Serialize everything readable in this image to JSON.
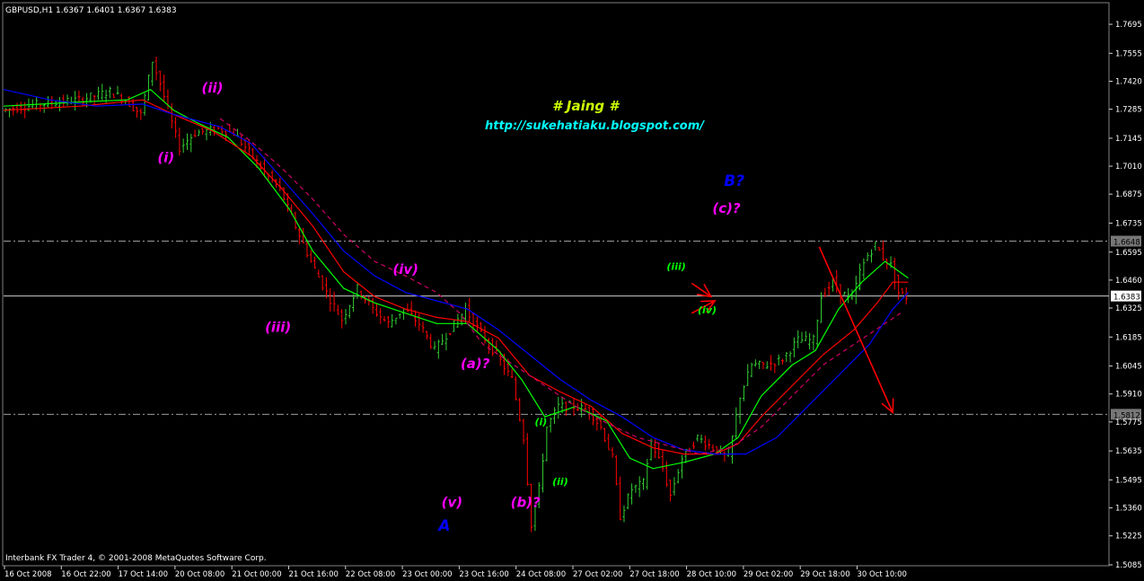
{
  "header": "GBPUSD,H1  1.6367 1.6401 1.6367 1.6383",
  "footer": "Interbank FX Trader 4, © 2001-2008 MetaQuotes Software Corp.",
  "watermark": {
    "title": "# Jaing #",
    "url": "http://sukehatiaku.blogspot.com/"
  },
  "colors": {
    "background": "#000000",
    "grid": "#808080",
    "bull": "#32CD32",
    "bear": "#FF0000",
    "ma_fast": "#00FF00",
    "ma_mid": "#FF0000",
    "ma_slow": "#0000FF",
    "ma_dashed": "#CC0066",
    "label_magenta": "#FF00FF",
    "label_blue": "#0000FF",
    "label_green": "#00FF00",
    "watermark_title": "#CCFF00",
    "watermark_url": "#00FFFF",
    "arrow": "#FF0000"
  },
  "chart_data": {
    "type": "candlestick",
    "symbol": "GBPUSD",
    "timeframe": "H1",
    "ylim": [
      1.5085,
      1.7795
    ],
    "x_ticks": [
      "16 Oct 2008",
      "16 Oct 22:00",
      "17 Oct 14:00",
      "20 Oct 08:00",
      "21 Oct 00:00",
      "21 Oct 16:00",
      "22 Oct 08:00",
      "23 Oct 00:00",
      "23 Oct 16:00",
      "24 Oct 08:00",
      "27 Oct 02:00",
      "27 Oct 18:00",
      "28 Oct 10:00",
      "29 Oct 02:00",
      "29 Oct 18:00",
      "30 Oct 10:00"
    ],
    "y_ticks": [
      "1.7695",
      "1.7555",
      "1.7420",
      "1.7285",
      "1.7145",
      "1.7010",
      "1.6875",
      "1.6735",
      "1.6595",
      "1.6460",
      "1.6325",
      "1.6185",
      "1.6045",
      "1.5910",
      "1.5775",
      "1.5635",
      "1.5495",
      "1.5360",
      "1.5225",
      "1.5085"
    ],
    "horizontal_lines": [
      {
        "value": 1.6648,
        "label": "1.6648",
        "style": "dashdot"
      },
      {
        "value": 1.5812,
        "label": "1.5812",
        "style": "dashdot"
      },
      {
        "value": 1.6383,
        "label": "1.6383",
        "style": "solid"
      }
    ],
    "price_path": [
      [
        0,
        1.728
      ],
      [
        10,
        1.731
      ],
      [
        20,
        1.733
      ],
      [
        28,
        1.737
      ],
      [
        32,
        1.733
      ],
      [
        36,
        1.726
      ],
      [
        39,
        1.752
      ],
      [
        41,
        1.741
      ],
      [
        44,
        1.722
      ],
      [
        46,
        1.71
      ],
      [
        50,
        1.717
      ],
      [
        56,
        1.719
      ],
      [
        60,
        1.717
      ],
      [
        64,
        1.708
      ],
      [
        68,
        1.698
      ],
      [
        72,
        1.69
      ],
      [
        76,
        1.672
      ],
      [
        80,
        1.655
      ],
      [
        84,
        1.64
      ],
      [
        88,
        1.627
      ],
      [
        92,
        1.642
      ],
      [
        96,
        1.632
      ],
      [
        100,
        1.625
      ],
      [
        104,
        1.632
      ],
      [
        108,
        1.625
      ],
      [
        112,
        1.612
      ],
      [
        116,
        1.622
      ],
      [
        120,
        1.632
      ],
      [
        124,
        1.62
      ],
      [
        128,
        1.61
      ],
      [
        132,
        1.598
      ],
      [
        135,
        1.57
      ],
      [
        137,
        1.528
      ],
      [
        139,
        1.545
      ],
      [
        141,
        1.575
      ],
      [
        144,
        1.585
      ],
      [
        148,
        1.585
      ],
      [
        152,
        1.583
      ],
      [
        155,
        1.575
      ],
      [
        158,
        1.56
      ],
      [
        160,
        1.532
      ],
      [
        163,
        1.545
      ],
      [
        166,
        1.548
      ],
      [
        168,
        1.568
      ],
      [
        171,
        1.555
      ],
      [
        173,
        1.542
      ],
      [
        176,
        1.56
      ],
      [
        180,
        1.57
      ],
      [
        184,
        1.565
      ],
      [
        188,
        1.56
      ],
      [
        191,
        1.59
      ],
      [
        194,
        1.605
      ],
      [
        198,
        1.605
      ],
      [
        202,
        1.608
      ],
      [
        206,
        1.617
      ],
      [
        210,
        1.617
      ],
      [
        212,
        1.638
      ],
      [
        215,
        1.645
      ],
      [
        217,
        1.64
      ],
      [
        220,
        1.637
      ],
      [
        222,
        1.65
      ],
      [
        224,
        1.658
      ],
      [
        226,
        1.663
      ],
      [
        228,
        1.657
      ],
      [
        230,
        1.653
      ],
      [
        232,
        1.64
      ],
      [
        234,
        1.638
      ]
    ],
    "moving_averages": [
      {
        "color_key": "ma_fast",
        "style": "solid",
        "points": [
          [
            0,
            1.73
          ],
          [
            20,
            1.732
          ],
          [
            32,
            1.733
          ],
          [
            38,
            1.738
          ],
          [
            44,
            1.728
          ],
          [
            50,
            1.722
          ],
          [
            58,
            1.715
          ],
          [
            66,
            1.7
          ],
          [
            74,
            1.68
          ],
          [
            80,
            1.66
          ],
          [
            88,
            1.642
          ],
          [
            96,
            1.635
          ],
          [
            104,
            1.63
          ],
          [
            112,
            1.625
          ],
          [
            120,
            1.625
          ],
          [
            128,
            1.612
          ],
          [
            134,
            1.598
          ],
          [
            140,
            1.58
          ],
          [
            148,
            1.585
          ],
          [
            156,
            1.578
          ],
          [
            162,
            1.56
          ],
          [
            168,
            1.555
          ],
          [
            176,
            1.558
          ],
          [
            184,
            1.562
          ],
          [
            190,
            1.57
          ],
          [
            196,
            1.59
          ],
          [
            204,
            1.605
          ],
          [
            210,
            1.612
          ],
          [
            216,
            1.632
          ],
          [
            222,
            1.645
          ],
          [
            228,
            1.655
          ],
          [
            234,
            1.647
          ]
        ]
      },
      {
        "color_key": "ma_mid",
        "style": "solid",
        "points": [
          [
            0,
            1.728
          ],
          [
            20,
            1.73
          ],
          [
            36,
            1.733
          ],
          [
            44,
            1.726
          ],
          [
            54,
            1.718
          ],
          [
            64,
            1.706
          ],
          [
            72,
            1.69
          ],
          [
            80,
            1.672
          ],
          [
            88,
            1.65
          ],
          [
            96,
            1.638
          ],
          [
            104,
            1.632
          ],
          [
            112,
            1.628
          ],
          [
            120,
            1.626
          ],
          [
            128,
            1.618
          ],
          [
            136,
            1.6
          ],
          [
            144,
            1.592
          ],
          [
            152,
            1.585
          ],
          [
            160,
            1.572
          ],
          [
            168,
            1.565
          ],
          [
            176,
            1.562
          ],
          [
            184,
            1.562
          ],
          [
            190,
            1.567
          ],
          [
            196,
            1.58
          ],
          [
            204,
            1.595
          ],
          [
            212,
            1.61
          ],
          [
            220,
            1.622
          ],
          [
            226,
            1.635
          ],
          [
            230,
            1.645
          ],
          [
            234,
            1.645
          ]
        ]
      },
      {
        "color_key": "ma_slow",
        "style": "solid",
        "points": [
          [
            0,
            1.738
          ],
          [
            12,
            1.733
          ],
          [
            24,
            1.73
          ],
          [
            36,
            1.731
          ],
          [
            44,
            1.726
          ],
          [
            56,
            1.72
          ],
          [
            64,
            1.712
          ],
          [
            72,
            1.695
          ],
          [
            80,
            1.678
          ],
          [
            88,
            1.66
          ],
          [
            96,
            1.648
          ],
          [
            104,
            1.64
          ],
          [
            112,
            1.636
          ],
          [
            120,
            1.632
          ],
          [
            128,
            1.622
          ],
          [
            136,
            1.61
          ],
          [
            144,
            1.598
          ],
          [
            152,
            1.588
          ],
          [
            160,
            1.58
          ],
          [
            168,
            1.57
          ],
          [
            176,
            1.564
          ],
          [
            184,
            1.562
          ],
          [
            192,
            1.562
          ],
          [
            200,
            1.57
          ],
          [
            208,
            1.585
          ],
          [
            216,
            1.6
          ],
          [
            224,
            1.615
          ],
          [
            230,
            1.632
          ],
          [
            234,
            1.64
          ]
        ]
      },
      {
        "color_key": "ma_dashed",
        "style": "dashed",
        "points": [
          [
            56,
            1.724
          ],
          [
            64,
            1.713
          ],
          [
            72,
            1.7
          ],
          [
            80,
            1.685
          ],
          [
            88,
            1.668
          ],
          [
            96,
            1.655
          ],
          [
            104,
            1.648
          ],
          [
            112,
            1.64
          ],
          [
            118,
            1.63
          ],
          [
            124,
            1.615
          ],
          [
            132,
            1.605
          ],
          [
            140,
            1.595
          ],
          [
            148,
            1.585
          ],
          [
            156,
            1.577
          ],
          [
            164,
            1.57
          ],
          [
            172,
            1.566
          ],
          [
            180,
            1.562
          ],
          [
            188,
            1.565
          ],
          [
            196,
            1.575
          ],
          [
            204,
            1.59
          ],
          [
            212,
            1.605
          ],
          [
            220,
            1.615
          ],
          [
            228,
            1.625
          ],
          [
            232,
            1.63
          ]
        ]
      }
    ]
  },
  "annotations": [
    {
      "text": "(ii)",
      "color_key": "label_magenta",
      "x": 54,
      "y": 1.7365
    },
    {
      "text": "(i)",
      "color_key": "label_magenta",
      "x": 42,
      "y": 1.703
    },
    {
      "text": "(iii)",
      "color_key": "label_magenta",
      "x": 71,
      "y": 1.621
    },
    {
      "text": "(iv)",
      "color_key": "label_magenta",
      "x": 104,
      "y": 1.649
    },
    {
      "text": "(a)?",
      "color_key": "label_magenta",
      "x": 122,
      "y": 1.6035
    },
    {
      "text": "(v)",
      "color_key": "label_magenta",
      "x": 116,
      "y": 1.5365
    },
    {
      "text": "A",
      "color_key": "label_blue",
      "x": 114,
      "y": 1.525
    },
    {
      "text": "(b)?",
      "color_key": "label_magenta",
      "x": 135,
      "y": 1.5365
    },
    {
      "text": "(i)",
      "color_key": "label_green",
      "x": 139,
      "y": 1.576
    },
    {
      "text": "(ii)",
      "color_key": "label_green",
      "x": 144,
      "y": 1.547
    },
    {
      "text": "(iii)",
      "color_key": "label_green",
      "x": 174,
      "y": 1.651
    },
    {
      "text": "(iv)",
      "color_key": "label_green",
      "x": 182,
      "y": 1.63
    },
    {
      "text": "(c)?",
      "color_key": "label_magenta",
      "x": 187,
      "y": 1.6785
    },
    {
      "text": "B?",
      "color_key": "label_blue",
      "x": 189,
      "y": 1.6915
    }
  ],
  "arrows": [
    {
      "from": [
        211,
        1.662
      ],
      "to": [
        230,
        1.582
      ],
      "color_key": "arrow"
    },
    {
      "from": [
        178,
        1.6445
      ],
      "to": [
        183,
        1.638
      ],
      "color_key": "arrow"
    },
    {
      "from": [
        178,
        1.63
      ],
      "to": [
        184,
        1.636
      ],
      "color_key": "arrow"
    }
  ]
}
